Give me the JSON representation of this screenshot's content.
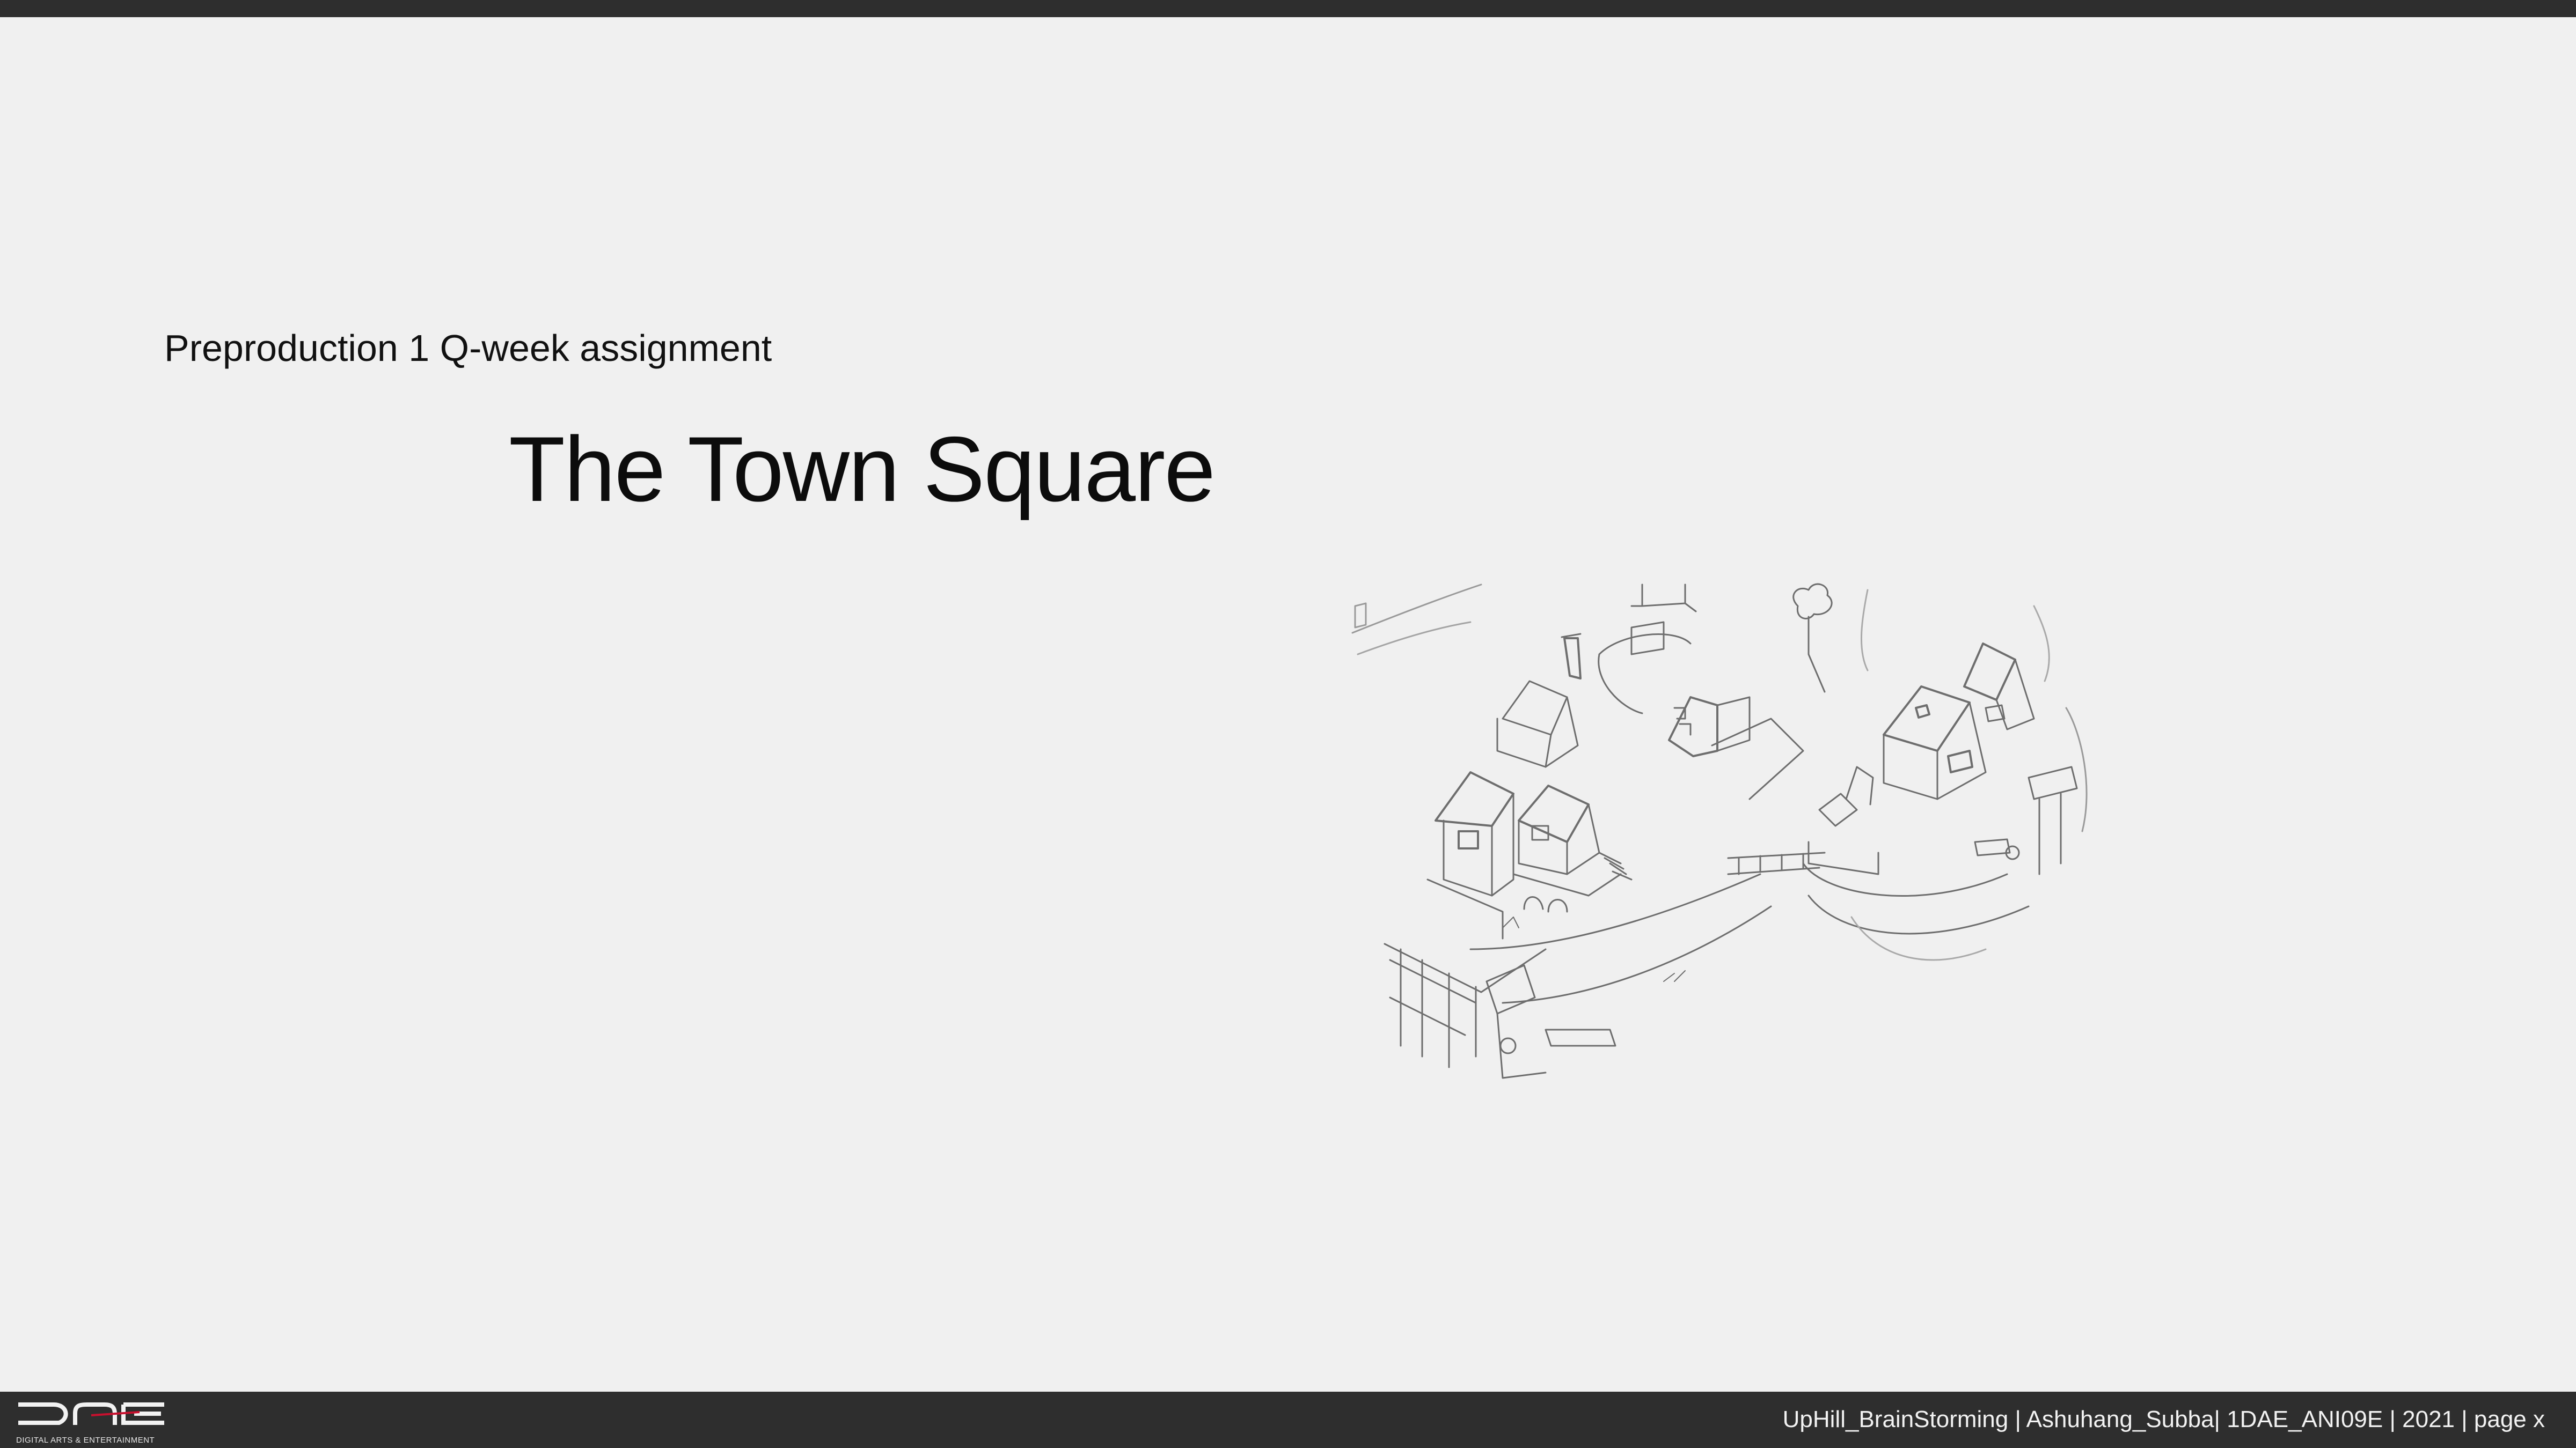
{
  "slide": {
    "subtitle": "Preproduction 1 Q-week assignment",
    "title": "The Town Square",
    "illustration": "pencil sketch of a hillside town square"
  },
  "footer": {
    "logo_tagline": "DIGITAL ARTS & ENTERTAINMENT",
    "text": "UpHill_BrainStorming | Ashuhang_Subba| 1DAE_ANI09E | 2021 | page x"
  },
  "colors": {
    "background": "#f0f0f0",
    "bars": "#2e2e2e",
    "logo_accent": "#c8102e",
    "sketch_line": "#6e6e6e"
  }
}
